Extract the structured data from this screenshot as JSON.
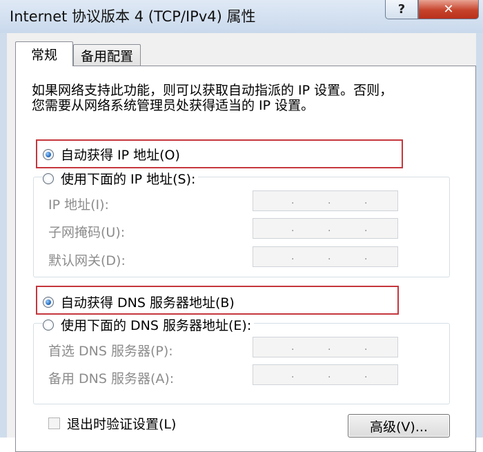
{
  "window": {
    "title": "Internet 协议版本 4 (TCP/IPv4) 属性",
    "help_label": "?",
    "close_label": "✕"
  },
  "tabs": [
    {
      "label": "常规",
      "active": true
    },
    {
      "label": "备用配置",
      "active": false
    }
  ],
  "description": {
    "line1": "如果网络支持此功能，则可以获取自动指派的 IP 设置。否则，",
    "line2": "您需要从网络系统管理员处获得适当的 IP 设置。"
  },
  "ip_section": {
    "auto_label": "自动获得 IP 地址(O)",
    "manual_label": "使用下面的 IP 地址(S):",
    "selected": "auto",
    "fields": [
      {
        "label": "IP 地址(I):",
        "value": ". . ."
      },
      {
        "label": "子网掩码(U):",
        "value": ". . ."
      },
      {
        "label": "默认网关(D):",
        "value": ". . ."
      }
    ]
  },
  "dns_section": {
    "auto_label": "自动获得 DNS 服务器地址(B)",
    "manual_label": "使用下面的 DNS 服务器地址(E):",
    "selected": "auto",
    "fields": [
      {
        "label": "首选 DNS 服务器(P):",
        "value": ". . ."
      },
      {
        "label": "备用 DNS 服务器(A):",
        "value": ". . ."
      }
    ]
  },
  "validate_label": "退出时验证设置(L)",
  "advanced_label": "高级(V)...",
  "colors": {
    "highlight_border": "#c5363c",
    "close_button": "#c7432b",
    "radio_dot": "#1a5fb4"
  }
}
